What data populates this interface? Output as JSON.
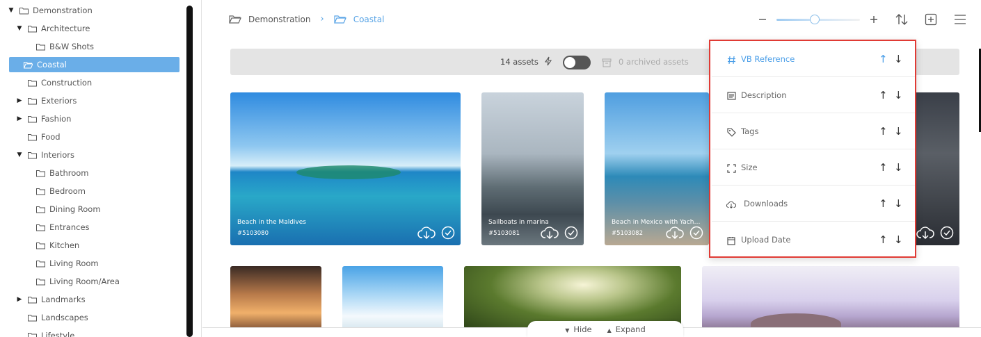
{
  "sidebar": {
    "items": [
      {
        "label": "Demonstration",
        "caret": "down",
        "level": 0
      },
      {
        "label": "Architecture",
        "caret": "down",
        "level": 1
      },
      {
        "label": "B&W Shots",
        "caret": "",
        "level": 2
      },
      {
        "label": "Coastal",
        "caret": "",
        "level": 1,
        "active": true
      },
      {
        "label": "Construction",
        "caret": "",
        "level": 1
      },
      {
        "label": "Exteriors",
        "caret": "right",
        "level": 1
      },
      {
        "label": "Fashion",
        "caret": "right",
        "level": 1
      },
      {
        "label": "Food",
        "caret": "",
        "level": 1
      },
      {
        "label": "Interiors",
        "caret": "down",
        "level": 1
      },
      {
        "label": "Bathroom",
        "caret": "",
        "level": 2
      },
      {
        "label": "Bedroom",
        "caret": "",
        "level": 2
      },
      {
        "label": "Dining Room",
        "caret": "",
        "level": 2
      },
      {
        "label": "Entrances",
        "caret": "",
        "level": 2
      },
      {
        "label": "Kitchen",
        "caret": "",
        "level": 2
      },
      {
        "label": "Living Room",
        "caret": "",
        "level": 2
      },
      {
        "label": "Living Room/Area",
        "caret": "",
        "level": 2
      },
      {
        "label": "Landmarks",
        "caret": "right",
        "level": 1
      },
      {
        "label": "Landscapes",
        "caret": "",
        "level": 1
      },
      {
        "label": "Lifestyle",
        "caret": "",
        "level": 1
      }
    ]
  },
  "breadcrumb": {
    "root": "Demonstration",
    "separator": "›",
    "current": "Coastal"
  },
  "toolbar": {
    "zoom_out_icon": "minus-icon",
    "zoom_in_icon": "plus-icon",
    "zoom_level": 0.45,
    "sort_icon": "sort-icon",
    "add_icon": "add-square-icon",
    "menu_icon": "hamburger-icon"
  },
  "status": {
    "assets": "14 assets",
    "archived": "0 archived assets",
    "toggle_on": false
  },
  "cards": [
    {
      "caption": "Beach in the Maldives",
      "ref": "#5103080",
      "theme": "maldives"
    },
    {
      "caption": "Sailboats in marina",
      "ref": "#5103081",
      "theme": "marina"
    },
    {
      "caption": "Beach in Mexico with Yacht ...",
      "ref": "#5103082",
      "theme": "mexico"
    },
    {
      "caption": "",
      "ref": "",
      "theme": "cliff"
    },
    {
      "caption": "",
      "ref": "",
      "theme": "sunset"
    },
    {
      "caption": "",
      "ref": "",
      "theme": "sky"
    },
    {
      "caption": "",
      "ref": "",
      "theme": "palm"
    },
    {
      "caption": "",
      "ref": "",
      "theme": "mountain"
    }
  ],
  "sort_menu": {
    "items": [
      {
        "label": "VB Reference",
        "icon": "hash-icon",
        "active": true
      },
      {
        "label": "Description",
        "icon": "description-icon",
        "active": false
      },
      {
        "label": "Tags",
        "icon": "tag-icon",
        "active": false
      },
      {
        "label": "Size",
        "icon": "size-icon",
        "active": false
      },
      {
        "label": "Downloads",
        "icon": "cloud-download-icon",
        "active": false
      },
      {
        "label": "Upload Date",
        "icon": "calendar-icon",
        "active": false
      }
    ],
    "up_glyph": "↑",
    "down_glyph": "↓"
  },
  "bottom": {
    "hide": "Hide",
    "expand": "Expand"
  },
  "colors": {
    "accent": "#5aa5e6",
    "active_folder": "#6aaee8",
    "highlight_border": "#e03a34"
  }
}
